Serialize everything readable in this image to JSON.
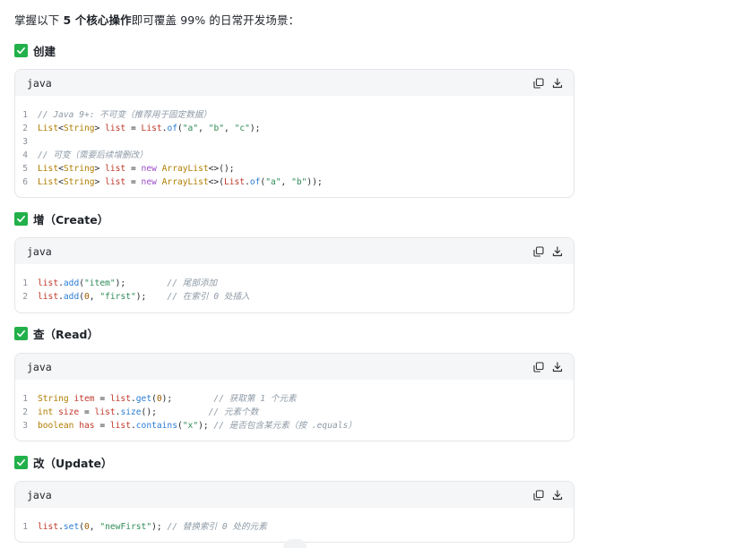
{
  "intro": {
    "before": "掌握以下 ",
    "bold": "5 个核心操作",
    "after": "即可覆盖 99% 的日常开发场景："
  },
  "sections": [
    {
      "heading": "创建",
      "lang": "java",
      "lines": [
        [
          [
            "comment",
            "// Java 9+: 不可变（推荐用于固定数据）"
          ]
        ],
        [
          [
            "type",
            "List"
          ],
          [
            "plain",
            "<"
          ],
          [
            "type",
            "String"
          ],
          [
            "plain",
            "> "
          ],
          [
            "var",
            "list"
          ],
          [
            "plain",
            " = "
          ],
          [
            "var",
            "List"
          ],
          [
            "plain",
            "."
          ],
          [
            "fn",
            "of"
          ],
          [
            "plain",
            "("
          ],
          [
            "str",
            "\"a\""
          ],
          [
            "plain",
            ", "
          ],
          [
            "str",
            "\"b\""
          ],
          [
            "plain",
            ", "
          ],
          [
            "str",
            "\"c\""
          ],
          [
            "plain",
            ");"
          ]
        ],
        [],
        [
          [
            "comment",
            "// 可变（需要后续增删改）"
          ]
        ],
        [
          [
            "type",
            "List"
          ],
          [
            "plain",
            "<"
          ],
          [
            "type",
            "String"
          ],
          [
            "plain",
            "> "
          ],
          [
            "var",
            "list"
          ],
          [
            "plain",
            " = "
          ],
          [
            "kw",
            "new"
          ],
          [
            "plain",
            " "
          ],
          [
            "type",
            "ArrayList"
          ],
          [
            "plain",
            "<>();"
          ]
        ],
        [
          [
            "type",
            "List"
          ],
          [
            "plain",
            "<"
          ],
          [
            "type",
            "String"
          ],
          [
            "plain",
            "> "
          ],
          [
            "var",
            "list"
          ],
          [
            "plain",
            " = "
          ],
          [
            "kw",
            "new"
          ],
          [
            "plain",
            " "
          ],
          [
            "type",
            "ArrayList"
          ],
          [
            "plain",
            "<>("
          ],
          [
            "var",
            "List"
          ],
          [
            "plain",
            "."
          ],
          [
            "fn",
            "of"
          ],
          [
            "plain",
            "("
          ],
          [
            "str",
            "\"a\""
          ],
          [
            "plain",
            ", "
          ],
          [
            "str",
            "\"b\""
          ],
          [
            "plain",
            "));"
          ]
        ]
      ]
    },
    {
      "heading": "增（Create）",
      "lang": "java",
      "lines": [
        [
          [
            "var",
            "list"
          ],
          [
            "plain",
            "."
          ],
          [
            "fn",
            "add"
          ],
          [
            "plain",
            "("
          ],
          [
            "str",
            "\"item\""
          ],
          [
            "plain",
            ");        "
          ],
          [
            "comment",
            "// 尾部添加"
          ]
        ],
        [
          [
            "var",
            "list"
          ],
          [
            "plain",
            "."
          ],
          [
            "fn",
            "add"
          ],
          [
            "plain",
            "("
          ],
          [
            "num",
            "0"
          ],
          [
            "plain",
            ", "
          ],
          [
            "str",
            "\"first\""
          ],
          [
            "plain",
            ");    "
          ],
          [
            "comment",
            "// 在索引 0 处插入"
          ]
        ]
      ]
    },
    {
      "heading": "查（Read）",
      "lang": "java",
      "lines": [
        [
          [
            "type",
            "String"
          ],
          [
            "plain",
            " "
          ],
          [
            "var",
            "item"
          ],
          [
            "plain",
            " = "
          ],
          [
            "var",
            "list"
          ],
          [
            "plain",
            "."
          ],
          [
            "fn",
            "get"
          ],
          [
            "plain",
            "("
          ],
          [
            "num",
            "0"
          ],
          [
            "plain",
            ");        "
          ],
          [
            "comment",
            "// 获取第 1 个元素"
          ]
        ],
        [
          [
            "type",
            "int"
          ],
          [
            "plain",
            " "
          ],
          [
            "var",
            "size"
          ],
          [
            "plain",
            " = "
          ],
          [
            "var",
            "list"
          ],
          [
            "plain",
            "."
          ],
          [
            "fn",
            "size"
          ],
          [
            "plain",
            "();          "
          ],
          [
            "comment",
            "// 元素个数"
          ]
        ],
        [
          [
            "type",
            "boolean"
          ],
          [
            "plain",
            " "
          ],
          [
            "var",
            "has"
          ],
          [
            "plain",
            " = "
          ],
          [
            "var",
            "list"
          ],
          [
            "plain",
            "."
          ],
          [
            "fn",
            "contains"
          ],
          [
            "plain",
            "("
          ],
          [
            "str",
            "\"x\""
          ],
          [
            "plain",
            "); "
          ],
          [
            "comment",
            "// 是否包含某元素（按 .equals）"
          ]
        ]
      ]
    },
    {
      "heading": "改（Update）",
      "lang": "java",
      "lines": [
        [
          [
            "var",
            "list"
          ],
          [
            "plain",
            "."
          ],
          [
            "fn",
            "set"
          ],
          [
            "plain",
            "("
          ],
          [
            "num",
            "0"
          ],
          [
            "plain",
            ", "
          ],
          [
            "str",
            "\"newFirst\""
          ],
          [
            "plain",
            "); "
          ],
          [
            "comment",
            "// 替换索引 0 处的元素"
          ]
        ]
      ]
    }
  ],
  "icons": {
    "check": "check-box-icon",
    "copy": "copy-icon",
    "download": "download-icon"
  },
  "colors": {
    "check_green": "#22b04b",
    "code_header_bg": "#f5f6f7"
  }
}
